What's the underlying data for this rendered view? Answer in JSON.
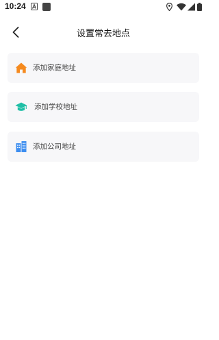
{
  "status_bar": {
    "time": "10:24"
  },
  "header": {
    "title": "设置常去地点"
  },
  "places": [
    {
      "label": "添加家庭地址",
      "icon": "home-icon",
      "color": "#f58a1f"
    },
    {
      "label": "添加学校地址",
      "icon": "graduation-cap-icon",
      "color": "#1fbfa6"
    },
    {
      "label": "添加公司地址",
      "icon": "office-building-icon",
      "color": "#3d8ef0"
    }
  ]
}
